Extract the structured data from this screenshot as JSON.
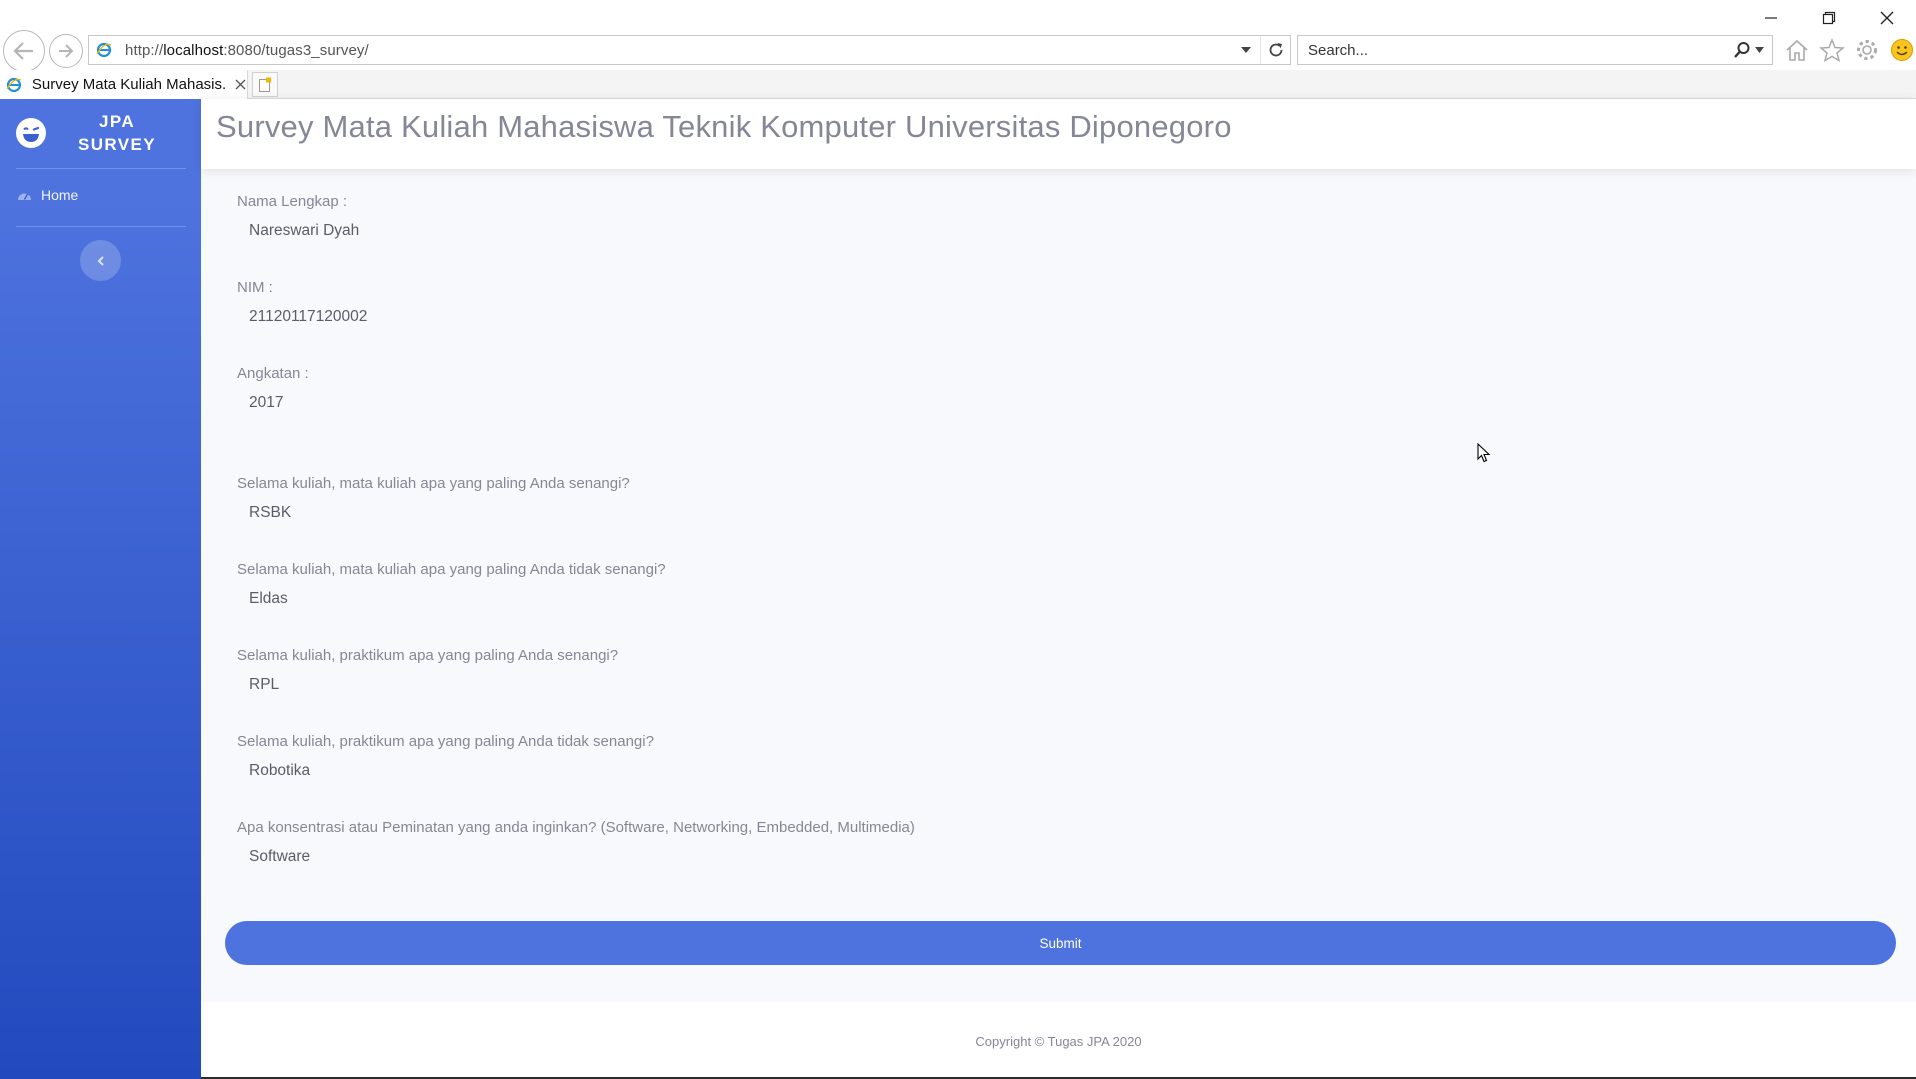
{
  "browser": {
    "url_prefix": "http://",
    "url_host": "localhost",
    "url_rest": ":8080/tugas3_survey/",
    "search_placeholder": "Search...",
    "tab_title": "Survey Mata Kuliah Mahasis..."
  },
  "sidebar": {
    "brand_line1": "JPA",
    "brand_line2": "SURVEY",
    "items": [
      {
        "label": "Home",
        "icon": "dashboard-icon"
      }
    ],
    "toggle_icon": "chevron-left-icon"
  },
  "header": {
    "title": "Survey Mata Kuliah Mahasiswa Teknik Komputer Universitas Diponegoro"
  },
  "form": {
    "fields": [
      {
        "label": "Nama Lengkap :",
        "value": "Nareswari Dyah"
      },
      {
        "label": "NIM :",
        "value": "21120117120002"
      },
      {
        "label": "Angkatan :",
        "value": "2017"
      },
      {
        "label": "Selama kuliah, mata kuliah apa yang paling Anda senangi?",
        "value": "RSBK"
      },
      {
        "label": "Selama kuliah, mata kuliah apa yang paling Anda tidak senangi?",
        "value": "Eldas"
      },
      {
        "label": "Selama kuliah, praktikum apa yang paling Anda senangi?",
        "value": "RPL"
      },
      {
        "label": "Selama kuliah, praktikum apa yang paling Anda tidak senangi?",
        "value": "Robotika"
      },
      {
        "label": "Apa konsentrasi atau Peminatan yang anda inginkan? (Software, Networking, Embedded, Multimedia)",
        "value": "Software"
      }
    ],
    "submit_label": "Submit"
  },
  "footer": {
    "copyright": "Copyright © Tugas JPA 2020"
  },
  "colors": {
    "primary": "#4e73df",
    "sidebar_bottom": "#224abe",
    "muted_text": "#858796",
    "body_text": "#5a5c69"
  }
}
